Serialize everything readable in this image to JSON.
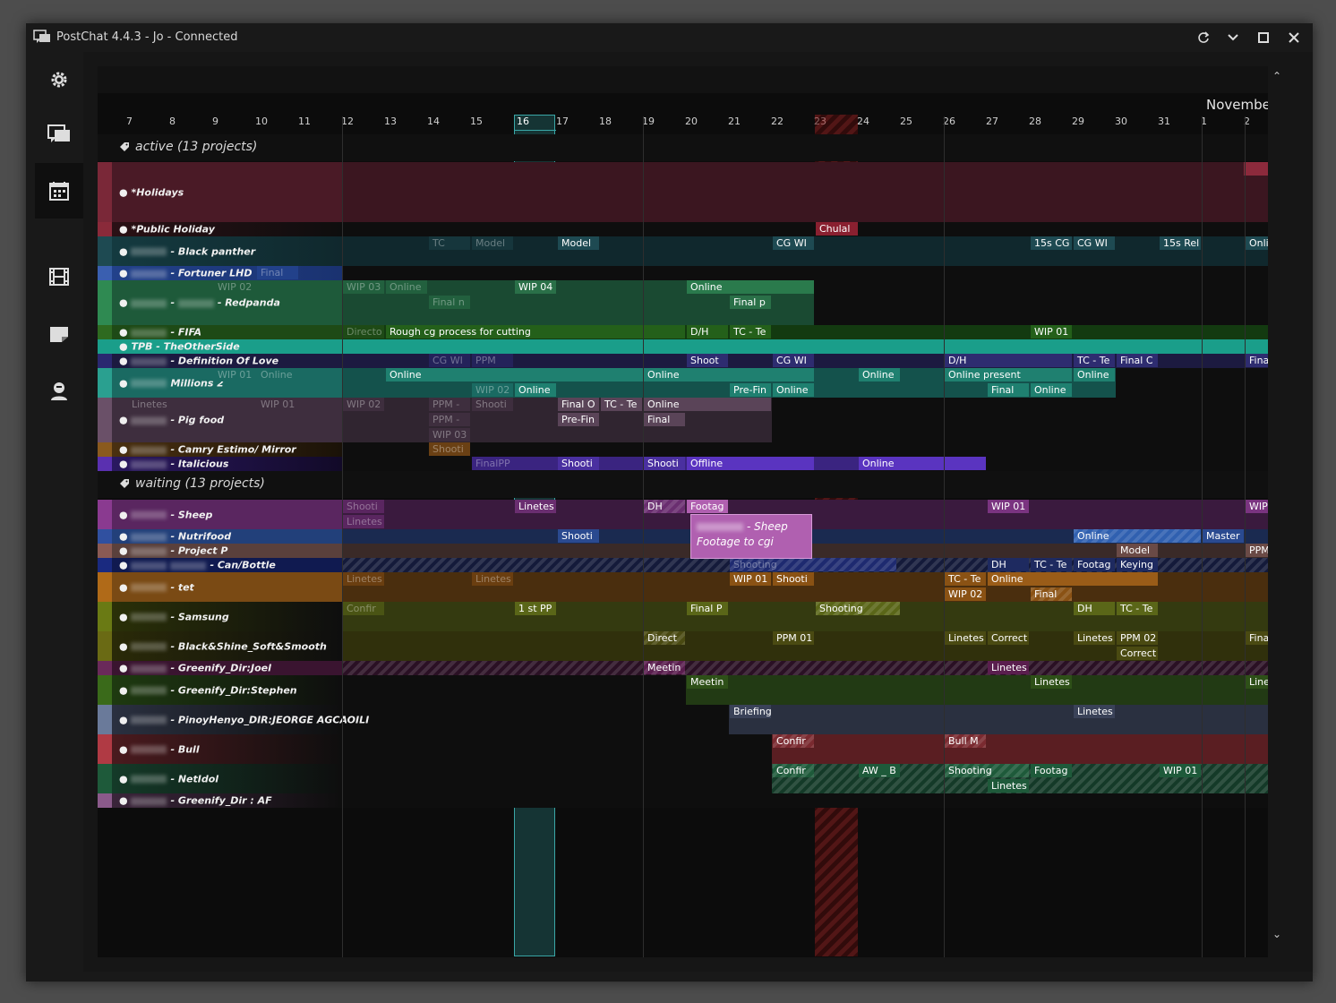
{
  "window": {
    "title": "PostChat 4.4.3 - Jo - Connected"
  },
  "sidebar": {
    "items": [
      {
        "icon": "settings-gear-icon"
      },
      {
        "icon": "chat-bubbles-icon"
      },
      {
        "icon": "calendar-icon"
      },
      {
        "icon": "film-strip-icon"
      },
      {
        "icon": "note-icon"
      },
      {
        "icon": "user-icon"
      }
    ]
  },
  "calendar": {
    "month": "Novembe",
    "days": [
      "7",
      "8",
      "9",
      "10",
      "11",
      "12",
      "13",
      "14",
      "15",
      "16",
      "17",
      "18",
      "19",
      "20",
      "21",
      "22",
      "23",
      "24",
      "25",
      "26",
      "27",
      "28",
      "29",
      "30",
      "31",
      "1",
      "2"
    ],
    "today": "16"
  },
  "groups": {
    "active": "active (13 projects)",
    "waiting": "waiting (13 projects)"
  },
  "projects": {
    "holidays": "*Holidays",
    "public_holiday": "*Public Holiday",
    "black_panther": "- Black panther",
    "fortuner": "- Fortuner LHD",
    "redpanda": "- Redpanda",
    "fifa": "- FIFA",
    "tpb": "TPB - TheOtherSide",
    "definition": "- Definition Of Love",
    "millions": "Millions 2",
    "pigfood": "- Pig food",
    "camry": "- Camry Estimo/ Mirror",
    "italicious": "- Italicious",
    "sheep": "- Sheep",
    "nutrifood": "- Nutrifood",
    "projectp": "- Project P",
    "canbottle": "- Can/Bottle",
    "tet": "- tet",
    "samsung": "- Samsung",
    "blackshine": "- Black&Shine_Soft&Smooth",
    "greenify_joel": "- Greenify_Dir:Joel",
    "greenify_stephen": "- Greenify_Dir:Stephen",
    "pinoy": "- PinoyHenyo_DIR:JEORGE AGCAOILI",
    "bull": "- Bull",
    "netidol": "- NetIdol",
    "greenify_af": "- Greenify_Dir : AF"
  },
  "bars": {
    "chulal": "Chulal",
    "tc": "TC",
    "model": "Model",
    "cgwi": "CG WI",
    "cg15": "15s CG",
    "rel15": "15s Rel",
    "onli": "Onli",
    "offline": "Offline",
    "final": "Final",
    "wip02": "WIP 02",
    "wip03": "WIP 03",
    "wip04": "WIP 04",
    "wip01": "WIP 01",
    "online": "Online",
    "final_p": "Final  p",
    "final_n": "Final  n",
    "directo": "Directo",
    "rough": "Rough cg process for cutting",
    "dh": "D/H",
    "tcte": "TC - Te",
    "ppm": "PPM",
    "shoot": "Shoot",
    "finalc": "Final C",
    "fina": "Fina",
    "online_present": "Online present",
    "prefin": "Pre-Fin",
    "lineteslbl": "Linetes",
    "ppm_dash": "PPM -",
    "shooti": "Shooti",
    "finalo": "Final O",
    "finalpp": "FinalPP",
    "footag": "Footag",
    "dh2": "DH",
    "wip": "WIP",
    "master": "Master",
    "keying": "Keying",
    "shooting": "Shooting",
    "confir": "Confir",
    "firstpp": "1 st PP",
    "finalp": "Final P",
    "direct": "Direct",
    "ppm01": "PPM 01",
    "correct": "Correct",
    "ppm02": "PPM 02",
    "meetin": "Meetin",
    "briefing": "Briefing",
    "bullm": "Bull M",
    "awb": "AW _ B",
    "line": "Line"
  },
  "tooltip": {
    "title": "- Sheep",
    "body": "Footage to cgi"
  }
}
